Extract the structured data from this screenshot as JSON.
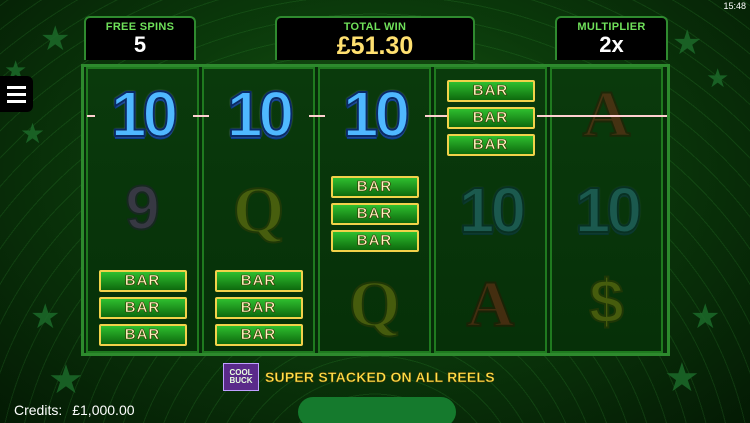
{
  "status": {
    "time": "15:48"
  },
  "panels": {
    "free_spins": {
      "label": "FREE SPINS",
      "value": "5"
    },
    "total_win": {
      "label": "TOTAL WIN",
      "value": "£51.30"
    },
    "multiplier": {
      "label": "MULTIPLIER",
      "value": "2x"
    }
  },
  "reels": [
    {
      "symbols": [
        "10",
        "9",
        "BAR",
        "BAR",
        "BAR"
      ]
    },
    {
      "symbols": [
        "10",
        "Q",
        "BAR",
        "BAR",
        "BAR"
      ]
    },
    {
      "symbols": [
        "10",
        "BAR",
        "BAR",
        "BAR",
        "Q"
      ]
    },
    {
      "symbols": [
        "BAR",
        "BAR",
        "BAR",
        "10",
        "A"
      ]
    },
    {
      "symbols": [
        "A",
        "10",
        "$"
      ]
    }
  ],
  "promo": {
    "logo_line1": "COOL",
    "logo_line2": "BUCK",
    "text": "SUPER STACKED ON ALL REELS"
  },
  "credits": {
    "label": "Credits:",
    "value": "£1,000.00"
  },
  "icons": {
    "menu": "hamburger-menu-icon"
  },
  "colors": {
    "accent_green": "#2d8a2d",
    "win_gold": "#ffe070",
    "label_green": "#6fe05a"
  }
}
